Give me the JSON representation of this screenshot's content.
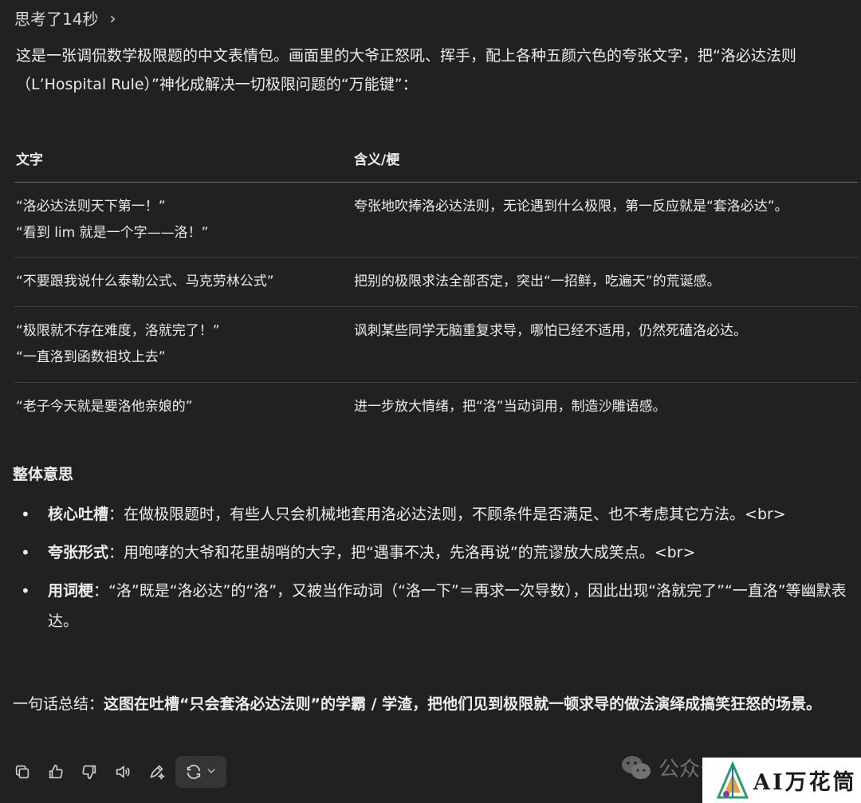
{
  "thought": {
    "label": "思考了14秒",
    "chevron": "›"
  },
  "intro": {
    "text": "这是一张调侃数学极限题的中文表情包。画面里的大爷正怒吼、挥手，配上各种五颜六色的夸张文字，把“洛必达法则（L’Hospital Rule）”神化成解决一切极限问题的“万能键”："
  },
  "table": {
    "headers": [
      "文字",
      "含义/梗"
    ],
    "rows": [
      {
        "text": [
          "“洛必达法则天下第一！”",
          "“看到 lim 就是一个字——洛！”"
        ],
        "meaning": "夸张地吹捧洛必达法则，无论遇到什么极限，第一反应就是“套洛必达”。"
      },
      {
        "text": [
          "“不要跟我说什么泰勒公式、马克劳林公式”"
        ],
        "meaning": "把别的极限求法全部否定，突出“一招鲜，吃遍天”的荒诞感。"
      },
      {
        "text": [
          "“极限就不存在难度，洛就完了！”",
          "“一直洛到函数祖坟上去”"
        ],
        "meaning": "讽刺某些同学无脑重复求导，哪怕已经不适用，仍然死磕洛必达。"
      },
      {
        "text": [
          "“老子今天就是要洛他亲娘的”"
        ],
        "meaning": "进一步放大情绪，把“洛”当动词用，制造沙雕语感。"
      }
    ]
  },
  "section": {
    "title": "整体意思"
  },
  "bullets": [
    {
      "label": "核心吐槽",
      "text": "：在做极限题时，有些人只会机械地套用洛必达法则，不顾条件是否满足、也不考虑其它方法。<br>"
    },
    {
      "label": "夸张形式",
      "text": "：用咆哮的大爷和花里胡哨的大字，把“遇事不决，先洛再说”的荒谬放大成笑点。<br>"
    },
    {
      "label": "用词梗",
      "text": "：“洛”既是“洛必达”的“洛”，又被当作动词（“洛一下”＝再求一次导数），因此出现“洛就完了”“一直洛”等幽默表达。"
    }
  ],
  "summary": {
    "lead": "一句话总结：",
    "bold": "这图在吐槽“只会套洛必达法则”的学霸 / 学渣，把他们见到极限就一顿求导的做法演绎成搞笑狂怒的场景。"
  },
  "actions": {
    "icons": [
      "copy-icon",
      "thumbs-up-icon",
      "thumbs-down-icon",
      "speaker-icon",
      "edit-icon",
      "regenerate-icon",
      "chevron-down-icon"
    ]
  },
  "watermark": {
    "text": "公众号"
  },
  "logo": {
    "text": "AI万花筒"
  }
}
